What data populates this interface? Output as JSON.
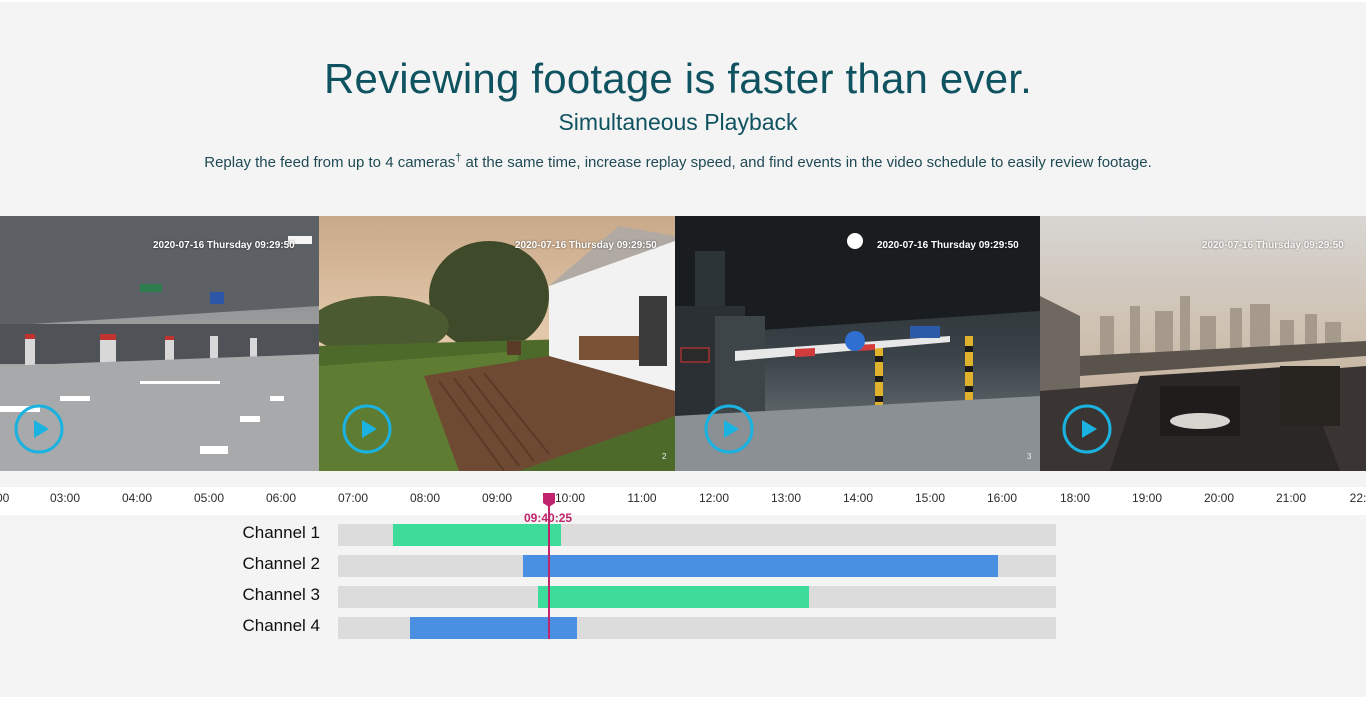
{
  "header": {
    "headline": "Reviewing footage is faster than ever.",
    "subhead": "Simultaneous Playback",
    "desc_before": "Replay the feed from up to 4 cameras",
    "desc_sup": "†",
    "desc_after": " at the same time, increase replay speed, and find events in the video schedule to easily review footage."
  },
  "cameras": [
    {
      "timestamp": "2020-07-16  Thursday 09:29:50",
      "num": ""
    },
    {
      "timestamp": "2020-07-16  Thursday 09:29:50",
      "num": "2"
    },
    {
      "timestamp": "2020-07-16  Thursday 09:29:50",
      "num": "3"
    },
    {
      "timestamp": "2020-07-16  Thursday 09:29:50",
      "num": ""
    }
  ],
  "timeline": {
    "ticks": [
      "00",
      "03:00",
      "04:00",
      "05:00",
      "06:00",
      "07:00",
      "08:00",
      "09:00",
      "10:00",
      "11:00",
      "12:00",
      "13:00",
      "14:00",
      "15:00",
      "16:00",
      "18:00",
      "19:00",
      "20:00",
      "21:00",
      "22:"
    ],
    "cursor_time": "09:40:25"
  },
  "channels": [
    {
      "label": "Channel 1",
      "color": "#3ddc9a"
    },
    {
      "label": "Channel 2",
      "color": "#4a90e2"
    },
    {
      "label": "Channel 3",
      "color": "#3ddc9a"
    },
    {
      "label": "Channel 4",
      "color": "#4a90e2"
    }
  ],
  "colors": {
    "accent": "#0f5260",
    "play_ring": "#1ab2e0",
    "cursor": "#c0246c",
    "green_segment": "#3ddc9a",
    "blue_segment": "#4a90e2"
  }
}
